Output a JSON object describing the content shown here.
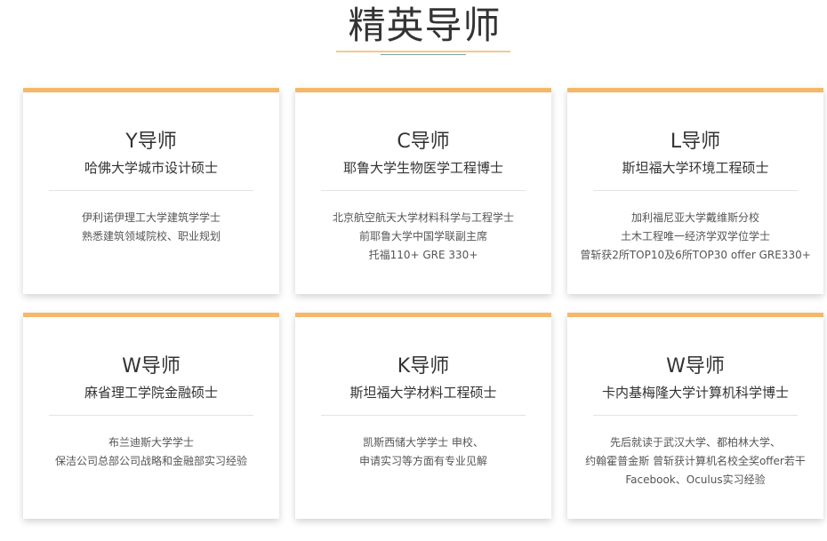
{
  "section": {
    "title": "精英导师"
  },
  "mentors": [
    {
      "name": "Y导师",
      "degree": "哈佛大学城市设计硕士",
      "details": [
        "伊利诺伊理工大学建筑学学士",
        "熟悉建筑领域院校、职业规划"
      ]
    },
    {
      "name": "C导师",
      "degree": "耶鲁大学生物医学工程博士",
      "details": [
        "北京航空航天大学材料科学与工程学士",
        "前耶鲁大学中国学联副主席",
        "托福110+ GRE 330+"
      ]
    },
    {
      "name": "L导师",
      "degree": "斯坦福大学环境工程硕士",
      "details": [
        "加利福尼亚大学戴维斯分校",
        "土木工程唯一经济学双学位学士",
        "曾斩获2所TOP10及6所TOP30 offer GRE330+"
      ]
    },
    {
      "name": "W导师",
      "degree": "麻省理工学院金融硕士",
      "details": [
        "布兰迪斯大学学士",
        "保洁公司总部公司战略和金融部实习经验"
      ]
    },
    {
      "name": "K导师",
      "degree": "斯坦福大学材料工程硕士",
      "details": [
        "凯斯西储大学学士 申校、",
        "申请实习等方面有专业见解"
      ]
    },
    {
      "name": "W导师",
      "degree": "卡内基梅隆大学计算机科学博士",
      "details": [
        "先后就读于武汉大学、都柏林大学、",
        "约翰霍普金斯 曾斩获计算机名校全奖offer若干",
        "Facebook、Oculus实习经验"
      ]
    }
  ],
  "colors": {
    "accent": "#f5b86a",
    "text": "#333333"
  }
}
